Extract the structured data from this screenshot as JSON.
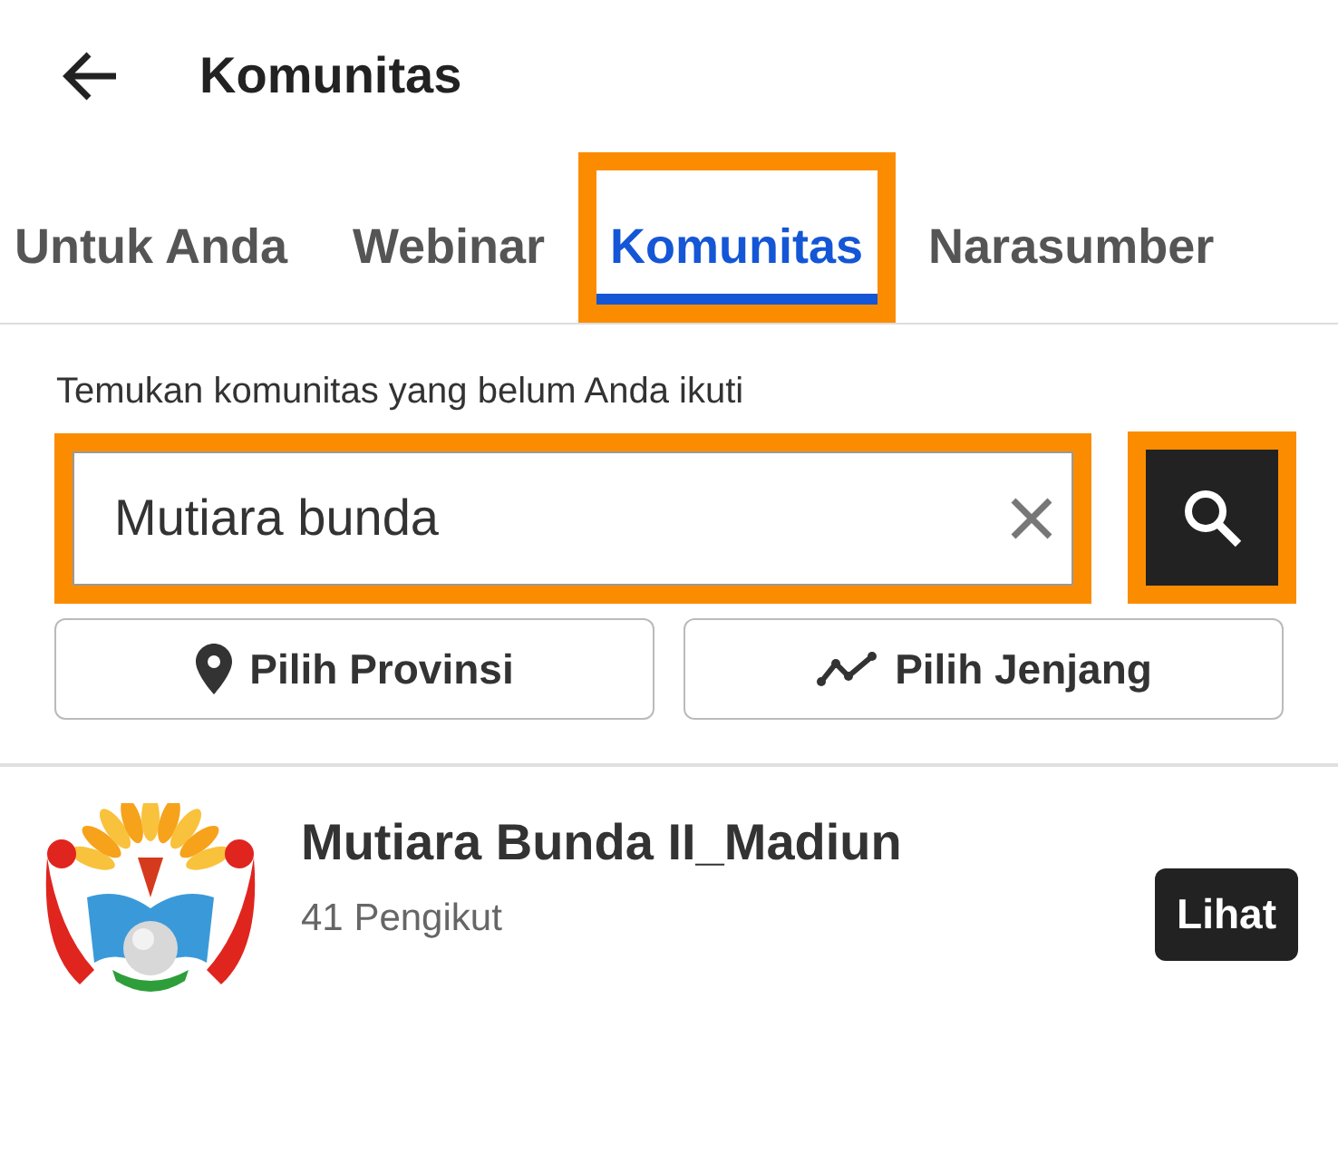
{
  "header": {
    "title": "Komunitas"
  },
  "tabs": [
    {
      "label": "Untuk Anda",
      "selected": false,
      "highlighted": false
    },
    {
      "label": "Webinar",
      "selected": false,
      "highlighted": false
    },
    {
      "label": "Komunitas",
      "selected": true,
      "highlighted": true
    },
    {
      "label": "Narasumber",
      "selected": false,
      "highlighted": false
    }
  ],
  "search": {
    "label": "Temukan komunitas yang belum Anda ikuti",
    "value": "Mutiara bunda",
    "field_highlighted": true,
    "button_highlighted": true
  },
  "filters": [
    {
      "kind": "location",
      "label": "Pilih Provinsi"
    },
    {
      "kind": "level",
      "label": "Pilih Jenjang"
    }
  ],
  "results": [
    {
      "kind": "picture",
      "name": "Mutiara Bunda II_Madiun",
      "followers": "41 Pengikut",
      "action": "Lihat"
    }
  ]
}
